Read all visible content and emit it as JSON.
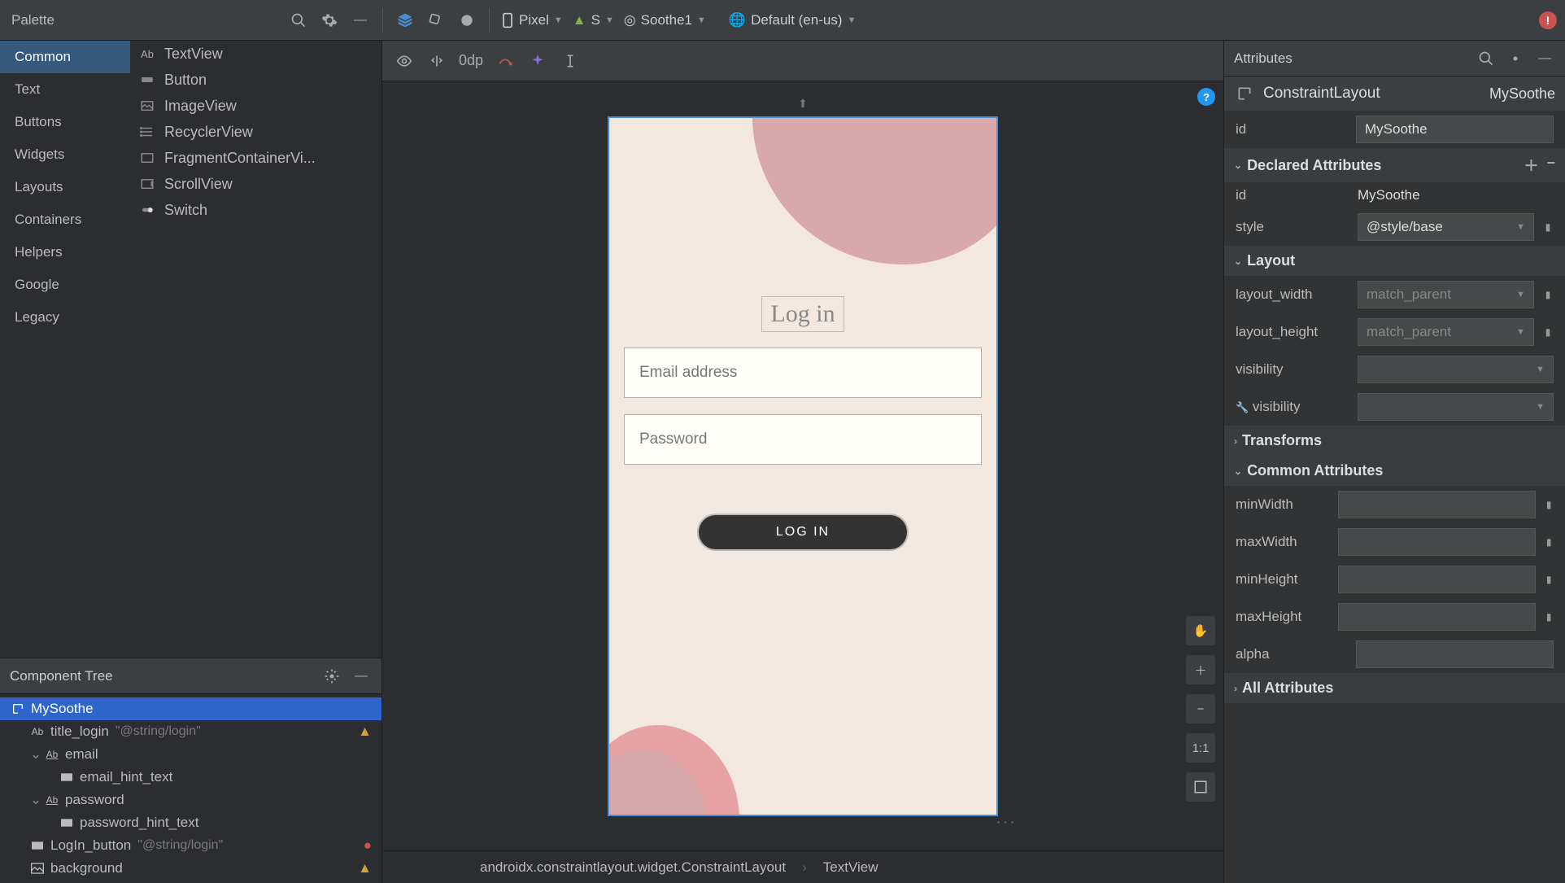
{
  "palette": {
    "title": "Palette",
    "categories": [
      "Common",
      "Text",
      "Buttons",
      "Widgets",
      "Layouts",
      "Containers",
      "Helpers",
      "Google",
      "Legacy"
    ],
    "items": [
      "TextView",
      "Button",
      "ImageView",
      "RecyclerView",
      "FragmentContainerVi...",
      "ScrollView",
      "Switch"
    ]
  },
  "toolbar": {
    "device": "Pixel",
    "api": "S",
    "theme": "Soothe1",
    "locale": "Default (en-us)",
    "zero_dp": "0dp"
  },
  "tree": {
    "title": "Component Tree",
    "root": "MySoothe",
    "items": [
      {
        "name": "title_login",
        "ref": "\"@string/login\"",
        "warn": true,
        "indent": 1,
        "icon": "Ab"
      },
      {
        "name": "email",
        "indent": 1,
        "expand": true,
        "icon": "Ab"
      },
      {
        "name": "email_hint_text",
        "indent": 2,
        "icon": "rect"
      },
      {
        "name": "password",
        "indent": 1,
        "expand": true,
        "icon": "Ab"
      },
      {
        "name": "password_hint_text",
        "indent": 2,
        "icon": "rect"
      },
      {
        "name": "LogIn_button",
        "ref": "\"@string/login\"",
        "err": true,
        "indent": 1,
        "icon": "rect"
      },
      {
        "name": "background",
        "warn": true,
        "indent": 1,
        "icon": "img"
      }
    ]
  },
  "preview": {
    "title": "Log in",
    "email_hint": "Email address",
    "password_hint": "Password",
    "button": "LOG IN"
  },
  "canvas_tools": {
    "ratio": "1:1"
  },
  "attributes": {
    "title": "Attributes",
    "class": "ConstraintLayout",
    "name": "MySoothe",
    "id_label": "id",
    "id_value": "MySoothe",
    "sections": {
      "declared": "Declared Attributes",
      "layout": "Layout",
      "transforms": "Transforms",
      "common": "Common Attributes",
      "all": "All Attributes"
    },
    "declared": [
      {
        "label": "id",
        "value": "MySoothe"
      },
      {
        "label": "style",
        "value": "@style/base",
        "dropdown": true
      }
    ],
    "layout": [
      {
        "label": "layout_width",
        "value": "match_parent",
        "dropdown": true,
        "faded": true
      },
      {
        "label": "layout_height",
        "value": "match_parent",
        "dropdown": true,
        "faded": true
      },
      {
        "label": "visibility",
        "value": "",
        "dropdown": true
      },
      {
        "label": "visibility",
        "value": "",
        "dropdown": true,
        "tools": true
      }
    ],
    "common": [
      {
        "label": "minWidth",
        "value": ""
      },
      {
        "label": "maxWidth",
        "value": ""
      },
      {
        "label": "minHeight",
        "value": ""
      },
      {
        "label": "maxHeight",
        "value": ""
      },
      {
        "label": "alpha",
        "value": ""
      }
    ]
  },
  "breadcrumb": {
    "a": "androidx.constraintlayout.widget.ConstraintLayout",
    "b": "TextView"
  }
}
